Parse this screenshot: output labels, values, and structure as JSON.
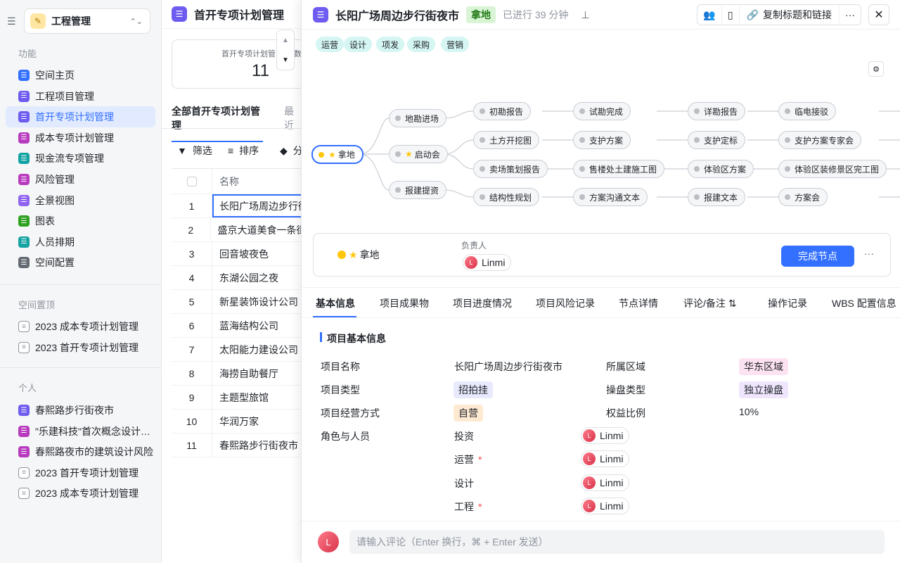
{
  "sidebar": {
    "collapse_icon": "sidebar-collapse-icon",
    "workspace": "工程管理",
    "section_features": "功能",
    "features": [
      {
        "label": "空间主页",
        "color": "#3370ff"
      },
      {
        "label": "工程项目管理",
        "color": "#6e5bf0"
      },
      {
        "label": "首开专项计划管理",
        "color": "#6e5bf0",
        "active": true
      },
      {
        "label": "成本专项计划管理",
        "color": "#b83bbf"
      },
      {
        "label": "现金流专项管理",
        "color": "#14a3a3"
      },
      {
        "label": "风险管理",
        "color": "#b83bbf"
      },
      {
        "label": "全景视图",
        "color": "#8f64f0"
      },
      {
        "label": "图表",
        "color": "#2ea121"
      },
      {
        "label": "人员排期",
        "color": "#14a3a3"
      },
      {
        "label": "空间配置",
        "color": "#646a73"
      }
    ],
    "section_pinned": "空间置顶",
    "pinned": [
      "2023 成本专项计划管理",
      "2023 首开专项计划管理"
    ],
    "section_personal": "个人",
    "personal": [
      {
        "label": "春熙路步行街夜市",
        "color": "#6e5bf0"
      },
      {
        "label": "\"乐建科技\"首次概念设计计...",
        "color": "#b83bbf"
      },
      {
        "label": "春熙路夜市的建筑设计风险",
        "color": "#b83bbf"
      },
      {
        "label": "2023 首开专项计划管理",
        "outline": true
      },
      {
        "label": "2023 成本专项计划管理",
        "outline": true
      }
    ]
  },
  "middle": {
    "title": "首开专项计划管理",
    "stat_label": "首开专项计划管",
    "stat_label2": "数",
    "stat_value": "11",
    "tab_all": "全部首开专项计划管理",
    "tab_recent": "最近",
    "filter": "筛选",
    "sort": "排序",
    "group": "分",
    "col_name": "名称",
    "rows": [
      {
        "n": "1",
        "name": "长阳广场周边步行街"
      },
      {
        "n": "2",
        "name": "盛京大道美食一条街"
      },
      {
        "n": "3",
        "name": "回音坡夜色"
      },
      {
        "n": "4",
        "name": "东湖公园之夜"
      },
      {
        "n": "5",
        "name": "新星装饰设计公司"
      },
      {
        "n": "6",
        "name": "蓝海结构公司"
      },
      {
        "n": "7",
        "name": "太阳能力建设公司"
      },
      {
        "n": "8",
        "name": "海捞自助餐厅"
      },
      {
        "n": "9",
        "name": "主题型旅馆"
      },
      {
        "n": "10",
        "name": "华润万家"
      },
      {
        "n": "11",
        "name": "春熙路步行街夜市"
      }
    ]
  },
  "panel": {
    "title": "长阳广场周边步行街夜市",
    "stage": "拿地",
    "elapsed": "已进行 39 分钟",
    "copy_link": "复制标题和链接",
    "chips": [
      "运营",
      "设计",
      "项发",
      "采购",
      "营销"
    ],
    "flow": {
      "root": "拿地",
      "branches": [
        "地勘进场",
        "启动会",
        "报建提资"
      ],
      "cols": [
        [
          "初勘报告",
          "土方开挖图",
          "卖场策划报告",
          "结构性规划"
        ],
        [
          "试勘完成",
          "支护方案",
          "售楼处土建施工图",
          "方案沟通文本"
        ],
        [
          "详勘报告",
          "支护定标",
          "体验区方案",
          "报建文本"
        ],
        [
          "临电接驳",
          "支护方案专家会",
          "体验区装修景区完工图",
          "方案会"
        ]
      ]
    },
    "node_card": {
      "name": "拿地",
      "owner_label": "负责人",
      "owner": "Linmi",
      "done": "完成节点"
    },
    "tabs": [
      "基本信息",
      "项目成果物",
      "项目进度情况",
      "项目风险记录",
      "节点详情",
      "评论/备注",
      "操作记录",
      "WBS 配置信息"
    ],
    "info_title": "项目基本信息",
    "fields": {
      "name_label": "项目名称",
      "name_value": "长阳广场周边步行街夜市",
      "region_label": "所属区域",
      "region_value": "华东区域",
      "type_label": "项目类型",
      "type_value": "招拍挂",
      "op_label": "操盘类型",
      "op_value": "独立操盘",
      "mode_label": "项目经营方式",
      "mode_value": "自营",
      "equity_label": "权益比例",
      "equity_value": "10%",
      "roles_label": "角色与人员"
    },
    "roles": [
      {
        "role": "投资",
        "req": "",
        "person": "Linmi"
      },
      {
        "role": "运营",
        "req": "*",
        "person": "Linmi"
      },
      {
        "role": "设计",
        "req": "",
        "person": "Linmi"
      },
      {
        "role": "工程",
        "req": "*",
        "person": "Linmi"
      }
    ],
    "comment_placeholder": "请输入评论（Enter 换行，⌘ + Enter 发送）",
    "user_initial": "L"
  }
}
